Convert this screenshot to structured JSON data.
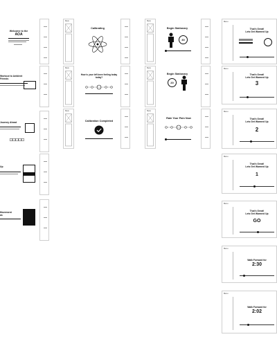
{
  "welcome": {
    "title": "Welcome to the",
    "brand": "AOA"
  },
  "calibrating": {
    "title": "Calibrating"
  },
  "stationary": {
    "title": "Begin Stationary",
    "count_a": "30",
    "count_b": "20"
  },
  "pain_question": {
    "title": "How is your left knee feeling today today?"
  },
  "calibration_complete": {
    "title": "Calibration Completed"
  },
  "rate_pain": {
    "title": "Rate Your Pain Now"
  },
  "countdown": [
    {
      "title": "That's Great!\nLets Get Warmed Up",
      "value": ""
    },
    {
      "title": "That's Great!\nLets Get Warmed Up",
      "value": "3"
    },
    {
      "title": "That's Great!\nLets Get Warmed Up",
      "value": "2"
    },
    {
      "title": "That's Great!\nLets Get Warmed Up",
      "value": "1"
    },
    {
      "title": "That's Great!\nLets Get Warmed Up",
      "value": "GO"
    },
    {
      "title": "Walk Forward for",
      "value": "2:30"
    },
    {
      "title": "Walk Forward for",
      "value": "2:02"
    }
  ],
  "left_panels": [
    {
      "title": "Workout to Ambient\nFriends"
    },
    {
      "title": "Journey Ahead"
    },
    {
      "title": "Up"
    },
    {
      "title": "Movement\nas"
    }
  ],
  "wire_label": "Menu"
}
